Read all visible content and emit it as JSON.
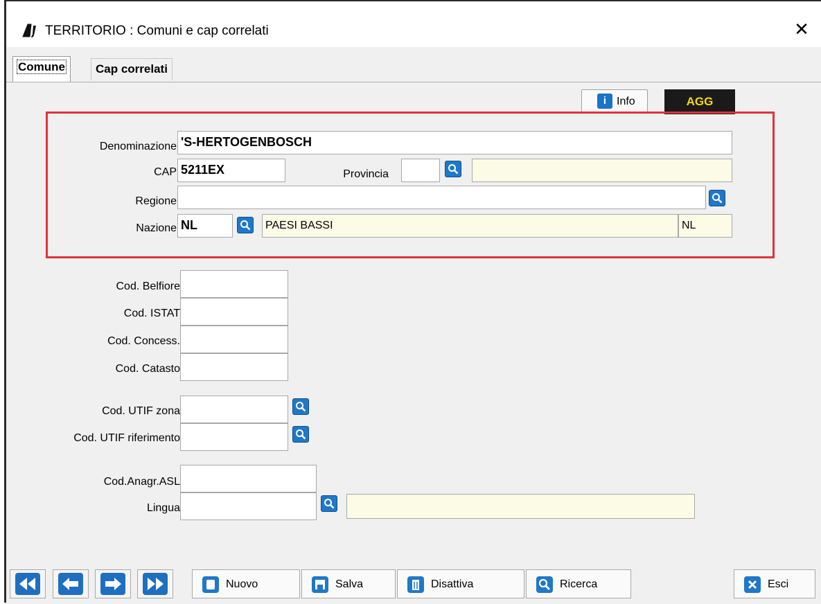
{
  "window": {
    "title": "TERRITORIO : Comuni e cap correlati"
  },
  "tabs": [
    {
      "label": "Comune",
      "active": true
    },
    {
      "label": "Cap correlati",
      "active": false
    }
  ],
  "top_actions": {
    "info_label": "Info",
    "mode_badge": "AGG"
  },
  "form": {
    "denominazione": {
      "label": "Denominazione",
      "value": "'S-HERTOGENBOSCH"
    },
    "cap": {
      "label": "CAP",
      "value": "5211EX"
    },
    "provincia": {
      "label": "Provincia",
      "value": "",
      "description": ""
    },
    "regione": {
      "label": "Regione",
      "value": ""
    },
    "nazione": {
      "label": "Nazione",
      "value": "NL",
      "description": "PAESI BASSI",
      "code": "NL"
    },
    "cod_belfiore": {
      "label": "Cod. Belfiore",
      "value": ""
    },
    "cod_istat": {
      "label": "Cod. ISTAT",
      "value": ""
    },
    "cod_concess": {
      "label": "Cod. Concess.",
      "value": ""
    },
    "cod_catasto": {
      "label": "Cod. Catasto",
      "value": ""
    },
    "cod_utif_zona": {
      "label": "Cod. UTIF zona",
      "value": ""
    },
    "cod_utif_riferimento": {
      "label": "Cod. UTIF riferimento",
      "value": ""
    },
    "cod_anagr_asl": {
      "label": "Cod.Anagr.ASL",
      "value": ""
    },
    "lingua": {
      "label": "Lingua",
      "value": "",
      "description": ""
    }
  },
  "toolbar": {
    "nuovo": "Nuovo",
    "salva": "Salva",
    "disattiva": "Disattiva",
    "ricerca": "Ricerca",
    "esci": "Esci"
  },
  "colors": {
    "highlight_border": "#e0323a",
    "accent_blue": "#1f78c8",
    "readonly_bg": "#fcfbe6",
    "badge_bg": "#1a1a1a",
    "badge_text": "#ffd800"
  }
}
